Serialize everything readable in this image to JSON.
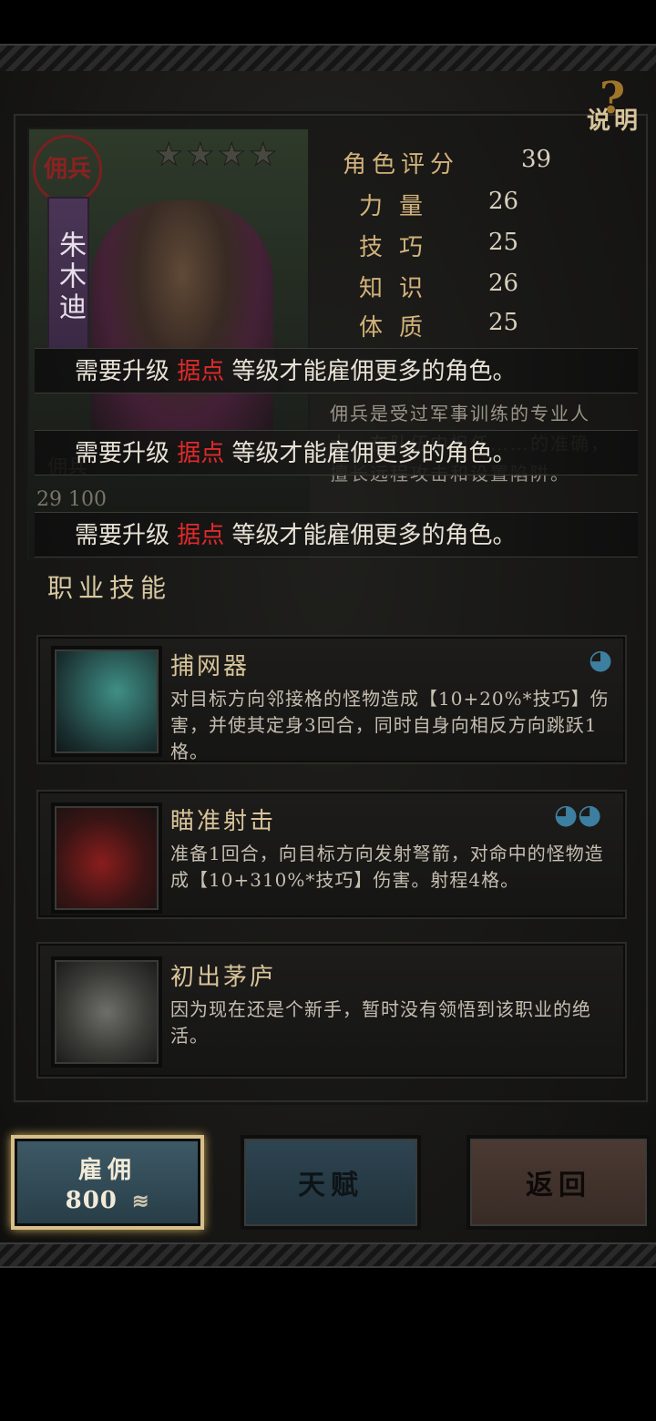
{
  "help": {
    "label": "说明"
  },
  "character": {
    "seal_text": "佣兵",
    "name": "朱木迪",
    "stars": [
      "★",
      "★",
      "★",
      "★"
    ],
    "class_label": "佣兵",
    "mini_stats": "29   100"
  },
  "stats": {
    "rating_label": "角色评分",
    "rating_value": "39",
    "items": [
      {
        "label": "力量",
        "value": "26"
      },
      {
        "label": "技巧",
        "value": "25"
      },
      {
        "label": "知识",
        "value": "26"
      },
      {
        "label": "体质",
        "value": "25"
      }
    ]
  },
  "description": "佣兵是受过军事训练的专业人士，在队伍中担任……的准确，擅长远程攻击和设置陷阱。",
  "toasts": [
    {
      "pre": "需要升级 ",
      "highlight": "据点",
      "post": " 等级才能雇佣更多的角色。"
    },
    {
      "pre": "需要升级 ",
      "highlight": "据点",
      "post": " 等级才能雇佣更多的角色。"
    },
    {
      "pre": "需要升级 ",
      "highlight": "据点",
      "post": " 等级才能雇佣更多的角色。"
    }
  ],
  "skills_section": {
    "title": "职业技能"
  },
  "skills": [
    {
      "name": "捕网器",
      "desc": "对目标方向邻接格的怪物造成【10+20%*技巧】伤害，并使其定身3回合，同时自身向相反方向跳跃1格。",
      "icon": "net-icon",
      "element": "water-icon"
    },
    {
      "name": "瞄准射击",
      "desc": "准备1回合，向目标方向发射弩箭，对命中的怪物造成【10+310%*技巧】伤害。射程4格。",
      "icon": "crossbow-target-icon",
      "element": "water-icon"
    },
    {
      "name": "初出茅庐",
      "desc": "因为现在还是个新手，暂时没有领悟到该职业的绝活。",
      "icon": "lock-icon",
      "element": ""
    }
  ],
  "buttons": {
    "hire_label": "雇佣",
    "hire_cost": "800",
    "talent_label": "天赋",
    "back_label": "返回"
  },
  "colors": {
    "accent": "#d7c08a",
    "highlight_red": "#e02a2a",
    "stat_gold": "#d2b27a"
  }
}
